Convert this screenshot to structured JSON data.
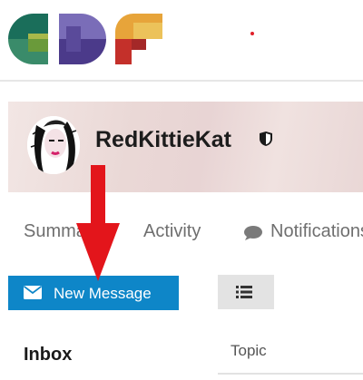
{
  "header": {
    "logo_text": "GDF"
  },
  "profile": {
    "username": "RedKittieKat"
  },
  "tabs": [
    {
      "label": "Summary"
    },
    {
      "label": "Activity"
    },
    {
      "label": "Notifications"
    }
  ],
  "actions": {
    "new_message_label": "New Message"
  },
  "sidebar": {
    "inbox_label": "Inbox"
  },
  "table": {
    "topic_header": "Topic"
  },
  "colors": {
    "primary_button": "#0e86c8",
    "annotation_arrow": "#e3151b"
  },
  "icons": {
    "mail": "envelope-icon",
    "list": "list-icon",
    "notification": "speech-bubble-icon",
    "badge": "shield-icon"
  }
}
